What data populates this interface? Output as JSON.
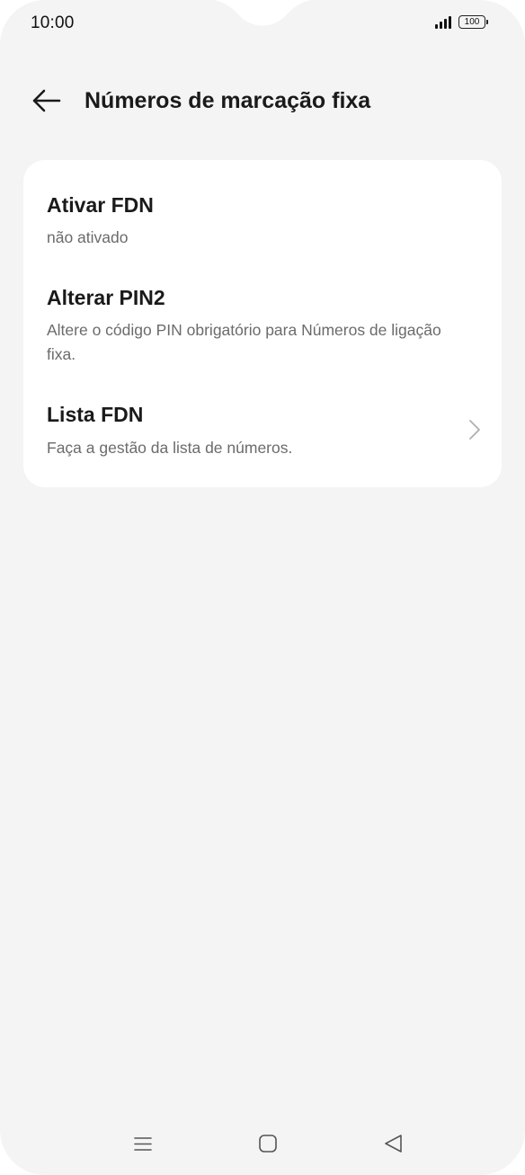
{
  "status_bar": {
    "time": "10:00",
    "battery": "100"
  },
  "header": {
    "title": "Números de marcação fixa"
  },
  "settings": {
    "items": [
      {
        "title": "Ativar FDN",
        "subtitle": "não ativado"
      },
      {
        "title": "Alterar PIN2",
        "subtitle": "Altere o código PIN obrigatório para Números de ligação fixa."
      },
      {
        "title": "Lista FDN",
        "subtitle": "Faça a gestão da lista de números."
      }
    ]
  },
  "icons": {
    "back": "arrow-left-icon",
    "chevron": "chevron-right-icon",
    "nav_menu": "menu-icon",
    "nav_home": "home-icon",
    "nav_back": "triangle-back-icon"
  },
  "colors": {
    "background": "#f4f4f4",
    "card": "#ffffff",
    "title_text": "#1a1a1a",
    "secondary_text": "#6b6b6b"
  }
}
